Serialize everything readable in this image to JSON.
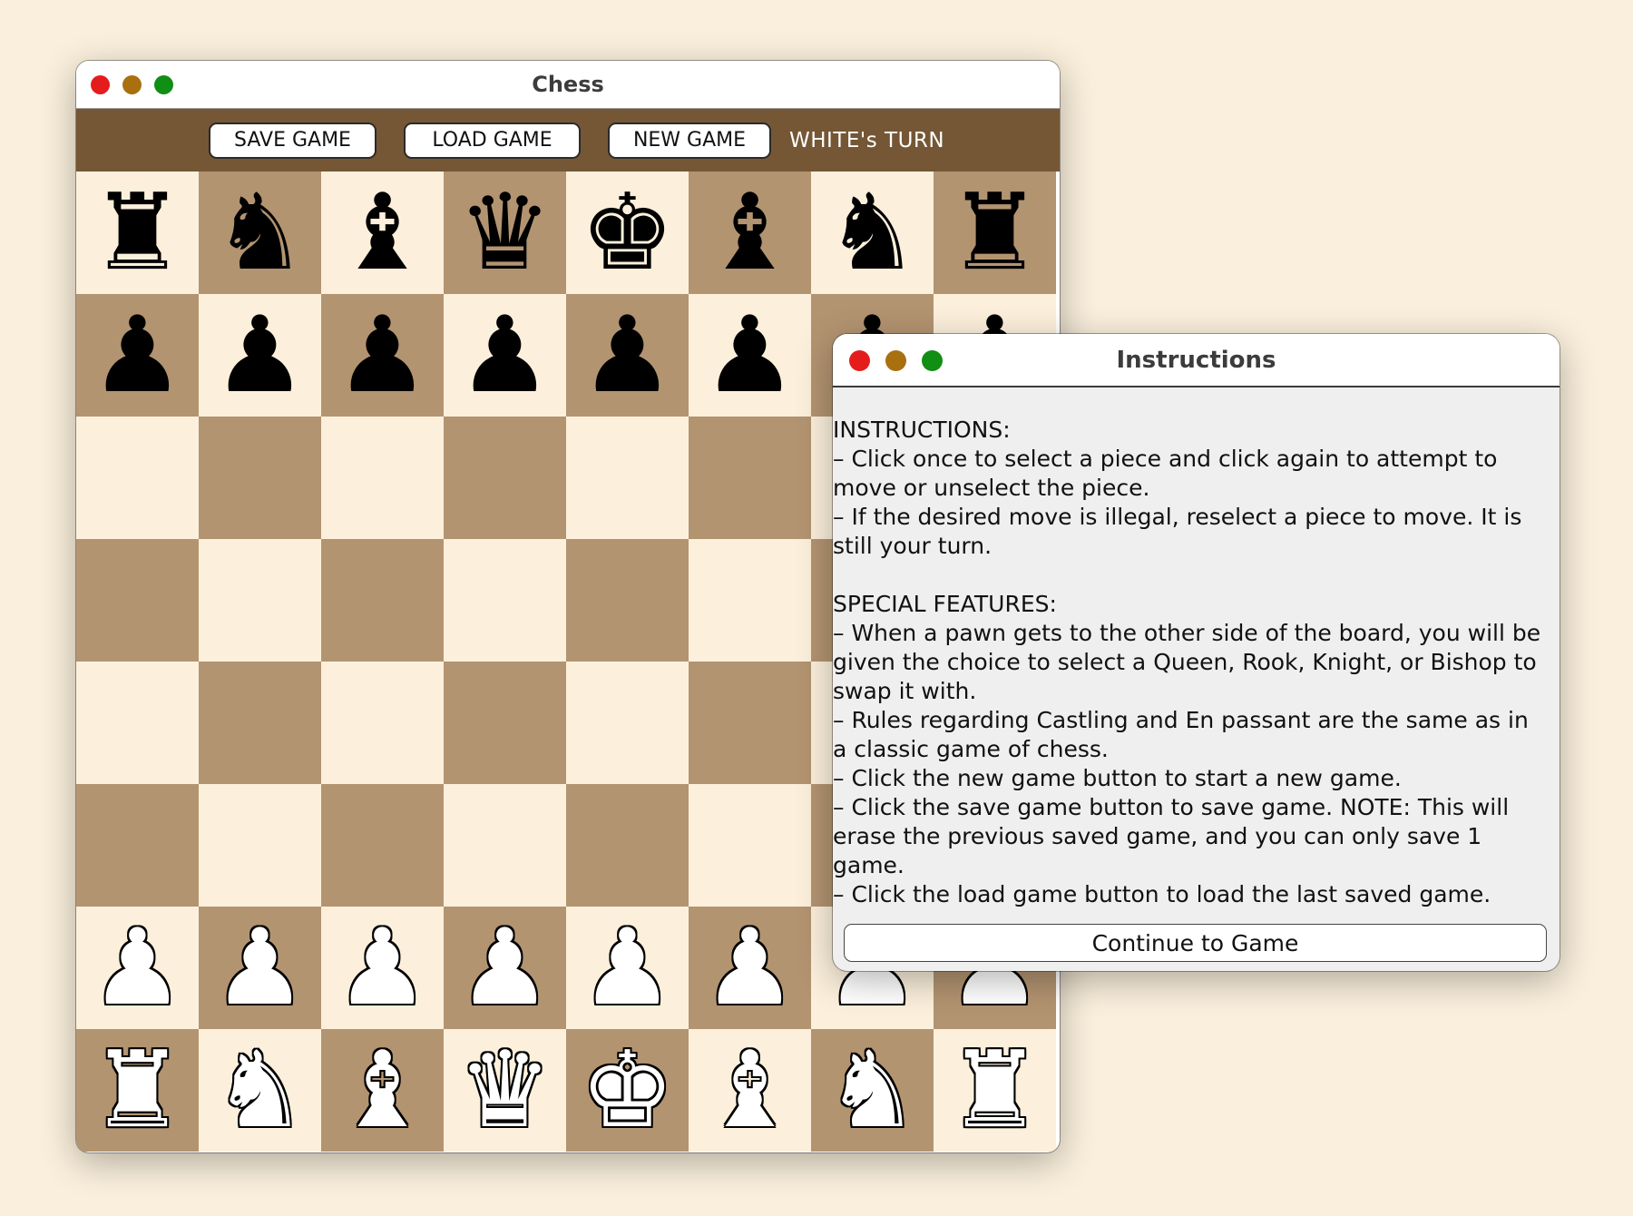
{
  "chess_window": {
    "title": "Chess",
    "toolbar": {
      "save_label": "SAVE GAME",
      "load_label": "LOAD GAME",
      "new_label": "NEW GAME",
      "turn_text": "WHITE's TURN"
    },
    "board": {
      "light_color": "#fcf0dc",
      "dark_color": "#b39471",
      "rows": [
        [
          "♜",
          "♞",
          "♝",
          "♛",
          "♚",
          "♝",
          "♞",
          "♜"
        ],
        [
          "♟",
          "♟",
          "♟",
          "♟",
          "♟",
          "♟",
          "♟",
          "♟"
        ],
        [
          "",
          "",
          "",
          "",
          "",
          "",
          "",
          ""
        ],
        [
          "",
          "",
          "",
          "",
          "",
          "",
          "",
          ""
        ],
        [
          "",
          "",
          "",
          "",
          "",
          "",
          "",
          ""
        ],
        [
          "",
          "",
          "",
          "",
          "",
          "",
          "",
          ""
        ],
        [
          "♟",
          "♟",
          "♟",
          "♟",
          "♟",
          "♟",
          "♟",
          "♟"
        ],
        [
          "♜",
          "♞",
          "♝",
          "♛",
          "♚",
          "♝",
          "♞",
          "♜"
        ]
      ],
      "piece_colors": [
        "black",
        "black",
        "",
        "",
        "",
        "",
        "white",
        "white"
      ]
    }
  },
  "instructions_window": {
    "title": "Instructions",
    "text": "INSTRUCTIONS:\n– Click once to select a piece and click again to attempt to move or unselect the piece.\n– If the desired move is illegal, reselect a piece to move. It is still your turn.\n\nSPECIAL FEATURES:\n– When a pawn gets to the other side of the board, you will be given the choice to select a Queen, Rook, Knight, or Bishop to swap it with.\n– Rules regarding Castling and En passant are the same as in a classic game of chess.\n– Click the new game button to start a new game.\n– Click the save game button to save game. NOTE: This will erase the previous saved game, and you can only save 1 game.\n– Click the load game button to load the last saved game.",
    "continue_label": "Continue to Game"
  },
  "colors": {
    "desktop_bg": "#faefdc",
    "toolbar_bg": "#755735",
    "traffic_red": "#e51c1c",
    "traffic_yellow": "#a8700f",
    "traffic_green": "#118e14"
  }
}
